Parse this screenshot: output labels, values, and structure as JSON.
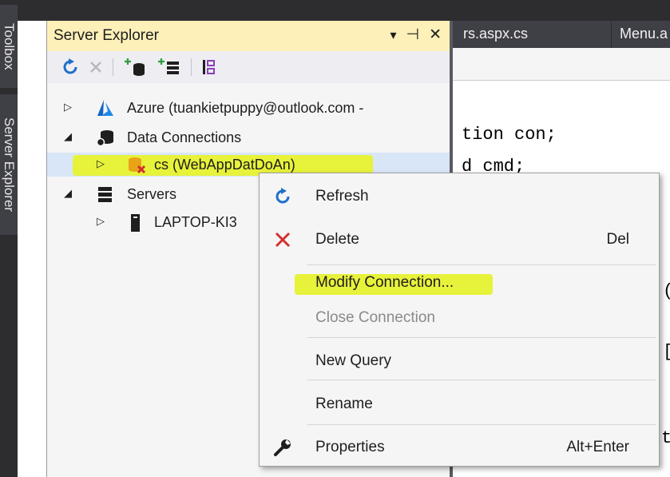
{
  "side_tabs": {
    "toolbox": "Toolbox",
    "server_explorer": "Server Explorer"
  },
  "panel": {
    "title": "Server Explorer",
    "header_icons": {
      "dropdown": "▾",
      "pin": "⊣",
      "close": "✕"
    },
    "toolbar_icons": [
      "refresh-icon",
      "delete-icon",
      "connect-database-icon",
      "connect-server-icon",
      "sharepoint-icon"
    ]
  },
  "tree": {
    "azure": "Azure (tuankietpuppy@outlook.com -",
    "data_connections": "Data Connections",
    "cs": "cs (WebAppDatDoAn)",
    "servers": "Servers",
    "laptop": "LAPTOP-KI3"
  },
  "tabs": {
    "tab1": "rs.aspx.cs",
    "tab2": "Menu.a"
  },
  "code": {
    "line1": "tion con;",
    "line2": "d cmd;",
    "paren": "(",
    "bracket": "[",
    "t": "t"
  },
  "context_menu": {
    "refresh": "Refresh",
    "delete": "Delete",
    "delete_shortcut": "Del",
    "modify": "Modify Connection...",
    "close": "Close Connection",
    "new_query": "New Query",
    "rename": "Rename",
    "properties": "Properties",
    "properties_shortcut": "Alt+Enter"
  },
  "colors": {
    "highlight": "#e7f23a",
    "panel_header": "#fdf0b8",
    "refresh_icon": "#1e6fc9",
    "delete_icon": "#d32f2f",
    "azure_icon": "#1565c0"
  }
}
